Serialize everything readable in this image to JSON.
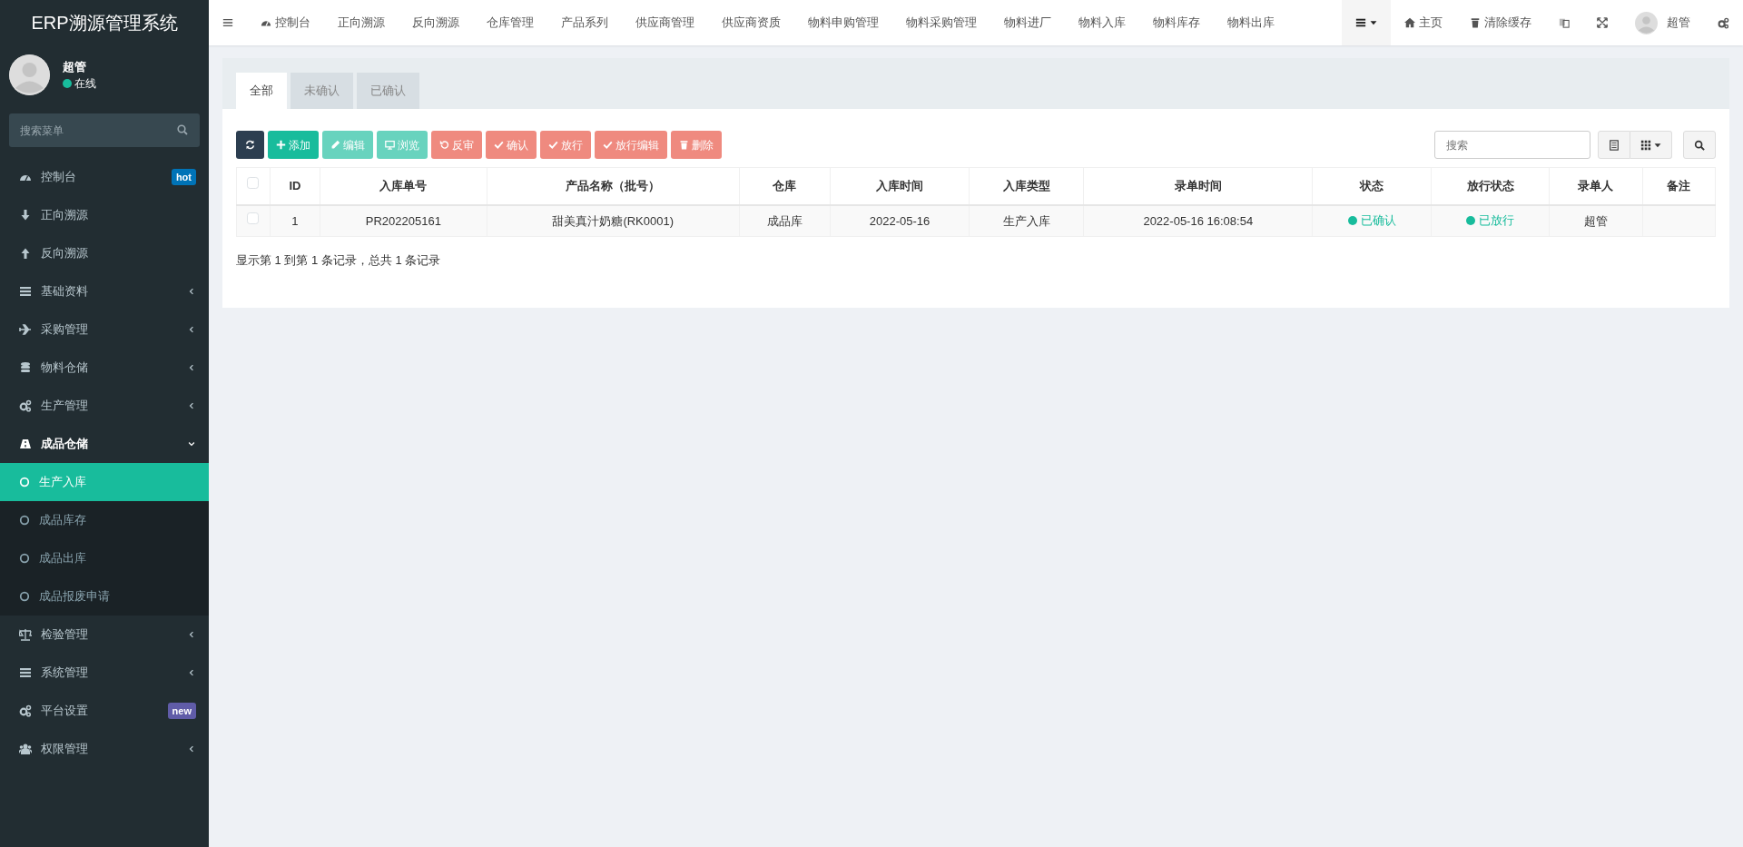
{
  "brand": "ERP溯源管理系统",
  "user": {
    "name": "超管",
    "status": "在线",
    "online": true
  },
  "sidebar": {
    "search": {
      "placeholder": "搜索菜单"
    },
    "items": [
      {
        "label": "控制台",
        "badge": {
          "text": "hot",
          "color": "#0073b7"
        }
      },
      {
        "label": "正向溯源"
      },
      {
        "label": "反向溯源"
      },
      {
        "label": "基础资料",
        "expanded": false
      },
      {
        "label": "采购管理",
        "expanded": false
      },
      {
        "label": "物料仓储",
        "expanded": false
      },
      {
        "label": "生产管理",
        "expanded": false
      },
      {
        "label": "成品仓储",
        "expanded": true,
        "children": [
          {
            "label": "生产入库",
            "selected": true
          },
          {
            "label": "成品库存",
            "selected": false
          },
          {
            "label": "成品出库",
            "selected": false
          },
          {
            "label": "成品报废申请",
            "selected": false
          }
        ]
      },
      {
        "label": "检验管理",
        "expanded": false
      },
      {
        "label": "系统管理",
        "expanded": false
      },
      {
        "label": "平台设置",
        "badge": {
          "text": "new",
          "color": "#605ca8"
        }
      },
      {
        "label": "权限管理",
        "expanded": false
      }
    ]
  },
  "topnav": {
    "links": [
      "控制台",
      "正向溯源",
      "反向溯源",
      "仓库管理",
      "产品系列",
      "供应商管理",
      "供应商资质",
      "物料申购管理",
      "物料采购管理",
      "物料进厂",
      "物料入库",
      "物料库存",
      "物料出库"
    ],
    "actions": [
      {
        "kind": "text",
        "label": "主页"
      },
      {
        "kind": "text",
        "label": "清除缓存"
      },
      {
        "kind": "icon"
      },
      {
        "kind": "icon"
      }
    ],
    "user": "超管"
  },
  "tabs": [
    {
      "label": "全部",
      "selected": true
    },
    {
      "label": "未确认",
      "selected": false
    },
    {
      "label": "已确认",
      "selected": false
    }
  ],
  "toolbar": [
    {
      "kind": "dark",
      "disabled": false
    },
    {
      "kind": "success",
      "label": "添加",
      "disabled": false
    },
    {
      "kind": "success",
      "label": "编辑",
      "disabled": true
    },
    {
      "kind": "success",
      "label": "浏览",
      "disabled": true
    },
    {
      "kind": "danger",
      "label": "反审",
      "disabled": true
    },
    {
      "kind": "danger",
      "label": "确认",
      "disabled": true
    },
    {
      "kind": "danger",
      "label": "放行",
      "disabled": true
    },
    {
      "kind": "danger",
      "label": "放行编辑",
      "disabled": true
    },
    {
      "kind": "danger",
      "label": "删除",
      "disabled": true
    }
  ],
  "search": {
    "placeholder": "搜索"
  },
  "table": {
    "columns": [
      "ID",
      "入库单号",
      "产品名称（批号）",
      "仓库",
      "入库时间",
      "入库类型",
      "录单时间",
      "状态",
      "放行状态",
      "录单人",
      "备注"
    ],
    "rows": [
      {
        "checked": false,
        "cells": [
          "1",
          "PR202205161",
          "甜美真汁奶糖(RK0001)",
          "成品库",
          "2022-05-16",
          "生产入库",
          "2022-05-16 16:08:54",
          {
            "text": "已确认",
            "color": "#18bc9c"
          },
          {
            "text": "已放行",
            "color": "#18bc9c"
          },
          "超管",
          ""
        ]
      }
    ]
  },
  "header_checked": false,
  "footer": "显示第 1 到第 1 条记录，总共 1 条记录"
}
